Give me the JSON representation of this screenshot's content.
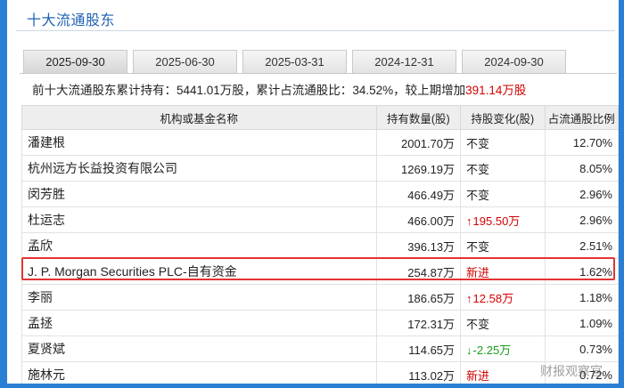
{
  "title": "十大流通股东",
  "tabs": [
    "2025-09-30",
    "2025-06-30",
    "2025-03-31",
    "2024-12-31",
    "2024-09-30"
  ],
  "summary": {
    "prefix": "前十大流通股东累计持有：",
    "holding": "5441.01万股",
    "mid": "，累计占流通股比：",
    "ratio": "34.52%",
    "mid2": "，较上期增加",
    "increase": "391.14万股"
  },
  "columns": [
    "机构或基金名称",
    "持有数量(股)",
    "持股变化(股)",
    "占流通股比例"
  ],
  "rows": [
    {
      "name": "潘建根",
      "qty": "2001.70万",
      "change": "不变",
      "change_type": "same",
      "pct": "12.70%"
    },
    {
      "name": "杭州远方长益投资有限公司",
      "qty": "1269.19万",
      "change": "不变",
      "change_type": "same",
      "pct": "8.05%"
    },
    {
      "name": "闵芳胜",
      "qty": "466.49万",
      "change": "不变",
      "change_type": "same",
      "pct": "2.96%"
    },
    {
      "name": "杜运志",
      "qty": "466.00万",
      "change": "195.50万",
      "change_type": "up",
      "pct": "2.96%"
    },
    {
      "name": "孟欣",
      "qty": "396.13万",
      "change": "不变",
      "change_type": "same",
      "pct": "2.51%"
    },
    {
      "name": "J. P. Morgan Securities PLC-自有资金",
      "qty": "254.87万",
      "change": "新进",
      "change_type": "new",
      "pct": "1.62%"
    },
    {
      "name": "李丽",
      "qty": "186.65万",
      "change": "12.58万",
      "change_type": "up",
      "pct": "1.18%"
    },
    {
      "name": "孟拯",
      "qty": "172.31万",
      "change": "不变",
      "change_type": "same",
      "pct": "1.09%"
    },
    {
      "name": "夏贤斌",
      "qty": "114.65万",
      "change": "-2.25万",
      "change_type": "down",
      "pct": "0.73%"
    },
    {
      "name": "施林元",
      "qty": "113.02万",
      "change": "新进",
      "change_type": "new",
      "pct": "0.72%"
    }
  ],
  "watermark": "财报观察官",
  "colors": {
    "up": "#d40000",
    "down": "#1a9a1a",
    "highlight": "#e53333",
    "title": "#1f62b0"
  }
}
